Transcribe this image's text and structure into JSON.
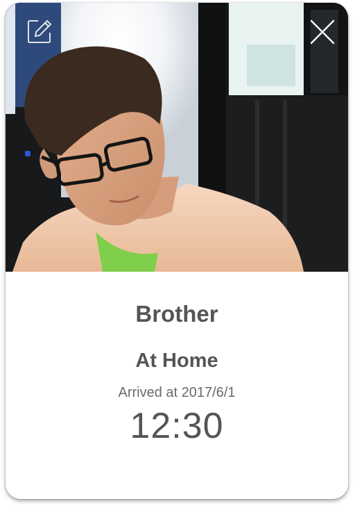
{
  "contact": {
    "name": "Brother",
    "status": "At Home",
    "arrived_label": "Arrived at 2017/6/1",
    "time": "12:30"
  },
  "icons": {
    "edit": "pencil-edit-icon",
    "close": "close-x-icon"
  },
  "colors": {
    "text": "#555555",
    "card_background": "#ffffff"
  }
}
